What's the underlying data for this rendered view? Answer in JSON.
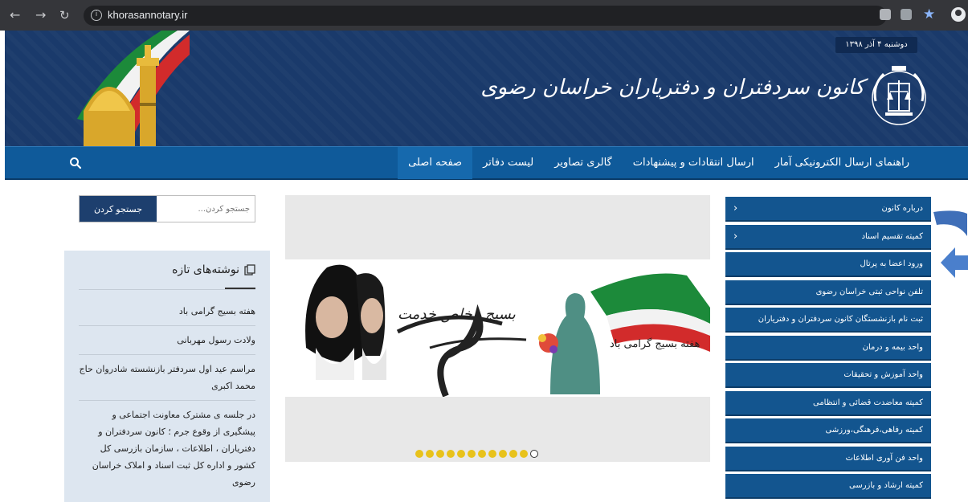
{
  "browser": {
    "url": "khorasannotary.ir",
    "nav_icons": [
      "back-arrow-icon",
      "forward-arrow-icon",
      "reload-icon"
    ],
    "accent": "#8ab4f8"
  },
  "header": {
    "date": "دوشنبه ۴ آذر ۱۳۹۸",
    "title": "کانون سردفتران و دفتریاران خراسان رضوی",
    "background": "#1a3a6b"
  },
  "menu": {
    "items": [
      {
        "label": "صفحه اصلی"
      },
      {
        "label": "لیست دفاتر"
      },
      {
        "label": "گالری تصاویر"
      },
      {
        "label": "ارسال انتقادات و پیشنهادات"
      },
      {
        "label": "راهنمای ارسال الکترونیکی آمار"
      }
    ],
    "background": "#0f5a9a"
  },
  "sidebar": {
    "items": [
      {
        "label": "درباره کانون",
        "has_submenu": true
      },
      {
        "label": "کمیته تقسیم اسناد",
        "has_submenu": true
      },
      {
        "label": "ورود اعضا به پرتال",
        "has_submenu": false
      },
      {
        "label": "تلفن نواحی ثبتی خراسان رضوی",
        "has_submenu": false
      },
      {
        "label": "ثبت نام بازنشستگان کانون سردفتران و دفتریاران",
        "has_submenu": false
      },
      {
        "label": "واحد بیمه و درمان",
        "has_submenu": false
      },
      {
        "label": "واحد آموزش و تحقیقات",
        "has_submenu": false
      },
      {
        "label": "کمیته معاضدت قضائی و انتظامی",
        "has_submenu": false
      },
      {
        "label": "کمیته رفاهی،فرهنگی،ورزشی",
        "has_submenu": false
      },
      {
        "label": "واحد فن آوری اطلاعات",
        "has_submenu": false
      },
      {
        "label": "کمیته ارشاد و بازرسی",
        "has_submenu": false
      }
    ]
  },
  "slider": {
    "banner_text": "هفته بسیج گرامی باد",
    "banner_calligraphy": "بسیج مخلص خدمت",
    "slide_count": 12,
    "active_index": 11,
    "dot_color": "#e8c21b"
  },
  "search": {
    "placeholder": "جستجو کردن...",
    "button_label": "جستجو کردن"
  },
  "recent_posts": {
    "heading": "نوشته‌های تازه",
    "items": [
      "هفته بسیج گرامی باد",
      "ولادت رسول مهربانی",
      "مراسم عید اول سردفتر بازنشسته شادروان حاج محمد اکبری",
      "در جلسه ی مشترک معاونت اجتماعی و پیشگیری از وقوع جرم ؛ کانون سردفتران و دفتریاران ، اطلاعات ، سازمان بازرسی کل کشور و اداره کل ثبت اسناد و املاک خراسان رضوی"
    ]
  }
}
